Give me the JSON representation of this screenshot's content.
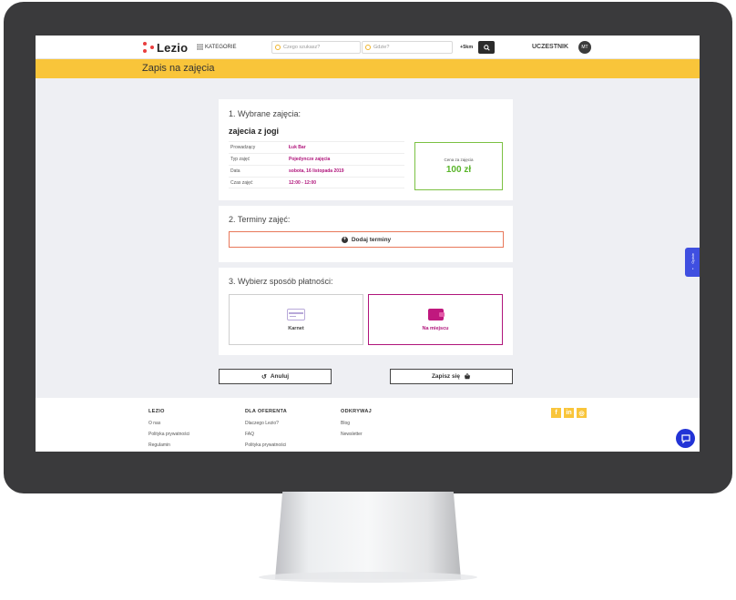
{
  "nav": {
    "logo_text": "Lezio",
    "categories_label": "KATEGORIE",
    "search_what_placeholder": "Czego szukasz?",
    "search_where_placeholder": "Gdzie?",
    "radius_label": "+5km",
    "user_role": "UCZESTNIK",
    "avatar_initials": "MT"
  },
  "page": {
    "title": "Zapis na zajęcia"
  },
  "selected_class": {
    "heading": "1. Wybrane zajęcia:",
    "name": "zajecia z jogi",
    "details": [
      {
        "label": "Prowadzący",
        "value": "Łuk Bar"
      },
      {
        "label": "Typ zajęć",
        "value": "Pojedyncze zajęcia"
      },
      {
        "label": "Data",
        "value": "sobota, 16 listopada 2019"
      },
      {
        "label": "Czas zajęć",
        "value": "12:00 - 12:00"
      }
    ],
    "price_label": "Cena za zajęcia",
    "price_value": "100 zł"
  },
  "terms": {
    "heading": "2. Terminy zajęć:",
    "add_button": "Dodaj terminy"
  },
  "payment": {
    "heading": "3. Wybierz sposób płatności:",
    "options": [
      {
        "label": "Karnet",
        "icon": "card-icon",
        "selected": false
      },
      {
        "label": "Na miejscu",
        "icon": "wallet-icon",
        "selected": true
      }
    ]
  },
  "actions": {
    "cancel": "Anuluj",
    "submit": "Zapisz się"
  },
  "footer": {
    "columns": [
      {
        "heading": "LEZIO",
        "links": [
          "O nas",
          "Polityka prywatności",
          "Regulamin"
        ]
      },
      {
        "heading": "DLA OFERENTA",
        "links": [
          "Dlaczego Lezio?",
          "FAQ",
          "Polityka prywatności"
        ]
      },
      {
        "heading": "ODKRYWAJ",
        "links": [
          "Blog",
          "Newsletter"
        ]
      }
    ],
    "social": [
      "facebook-icon",
      "linkedin-icon",
      "instagram-icon"
    ]
  },
  "side_tab": {
    "label": "Opinie"
  },
  "colors": {
    "accent_yellow": "#f9c53a",
    "brand_magenta": "#b0157b",
    "price_green": "#5ab52a",
    "chat_blue": "#2233d6"
  }
}
